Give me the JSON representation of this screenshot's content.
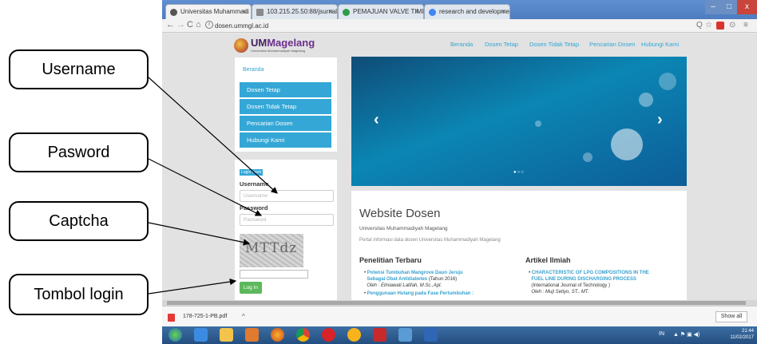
{
  "browser": {
    "tabs": [
      {
        "label": "Universitas Muhammadi",
        "color": "#555555"
      },
      {
        "label": "103.215.25.50:88/jsurnal",
        "color": "#8a8a8a"
      },
      {
        "label": "PEMAJUAN VALVE TIMI",
        "color": "#2e9c48"
      },
      {
        "label": "research and developme",
        "color": "#4285f4"
      }
    ],
    "close_glyph": "×",
    "url": "dosen.ummgl.ac.id",
    "info_glyph": "i",
    "nav": {
      "back": "←",
      "forward": "→",
      "reload": "C",
      "home": "⌂"
    },
    "toolbar": {
      "zoom": "Q",
      "star": "☆",
      "ext": "⊙",
      "menu": "≡"
    },
    "window_controls": {
      "minimize": "–",
      "maximize": "□",
      "close": "x"
    }
  },
  "site": {
    "logo_text": "UMMagelang",
    "logo_prefix": "UM",
    "logo_rest": "Magelang",
    "logo_sub": "Universitas Muhammadiyah Magelang",
    "topnav": [
      "Beranda",
      "Dosen Tetap",
      "Dosen Tidak Tetap",
      "Pencarian Dosen",
      "Hubungi Kami"
    ],
    "sidebar": {
      "home": "Beranda",
      "items": [
        "Dosen Tetap",
        "Dosen Tidak Tetap",
        "Pencarian Dosen",
        "Hubungi Kami"
      ]
    },
    "login": {
      "badge": "Login Form",
      "username_label": "Username",
      "username_placeholder": "Username",
      "password_label": "Password",
      "password_placeholder": "Password",
      "captcha_text": "MTTdz",
      "button": "Log In"
    },
    "slider": {
      "prev": "‹",
      "next": "›",
      "dots": "●○○"
    },
    "content": {
      "title": "Website Dosen",
      "subtitle": "Universitas Muhammadiyah Magelang",
      "portal": "Portal informasi data dosen Universitas Muhammadiyah Magelang",
      "research_heading": "Penelitian Terbaru",
      "article_heading": "Artikel Ilmiah",
      "research_items": [
        {
          "title": "Potensi Tumbuhan Mangrove Daun Jeruju",
          "title2": "Sebagai Obat Antidiabetes",
          "year": "(Tahun 2016)",
          "by": "Oleh : Elmiawati Latifah, M.Sc.,Apt."
        },
        {
          "title": "Penggunaan Hutang pada Fase Pertumbuhan :",
          "title2": "",
          "year": "",
          "by": ""
        }
      ],
      "article_items": [
        {
          "title": "CHARACTERISTIC OF LPG COMPOSITIONS IN THE",
          "title2": "FUEL LINE DURING DISCHARGING PROCESS",
          "journal": "(International Journal of Technology )",
          "by": "Oleh : Muji Setiyo, ST., MT."
        }
      ]
    }
  },
  "downloads": {
    "file": "178-725-1-PB.pdf",
    "caret": "^",
    "show_all": "Show all"
  },
  "taskbar": {
    "lang": "IN",
    "time": "21:44",
    "date": "11/02/2017"
  },
  "annotations": {
    "username": "Username",
    "password": "Pasword",
    "captcha": "Captcha",
    "login_button": "Tombol login"
  },
  "colors": {
    "accent": "#34a7d6",
    "login_button": "#5cb85c",
    "brand": "#6c2f8e"
  }
}
